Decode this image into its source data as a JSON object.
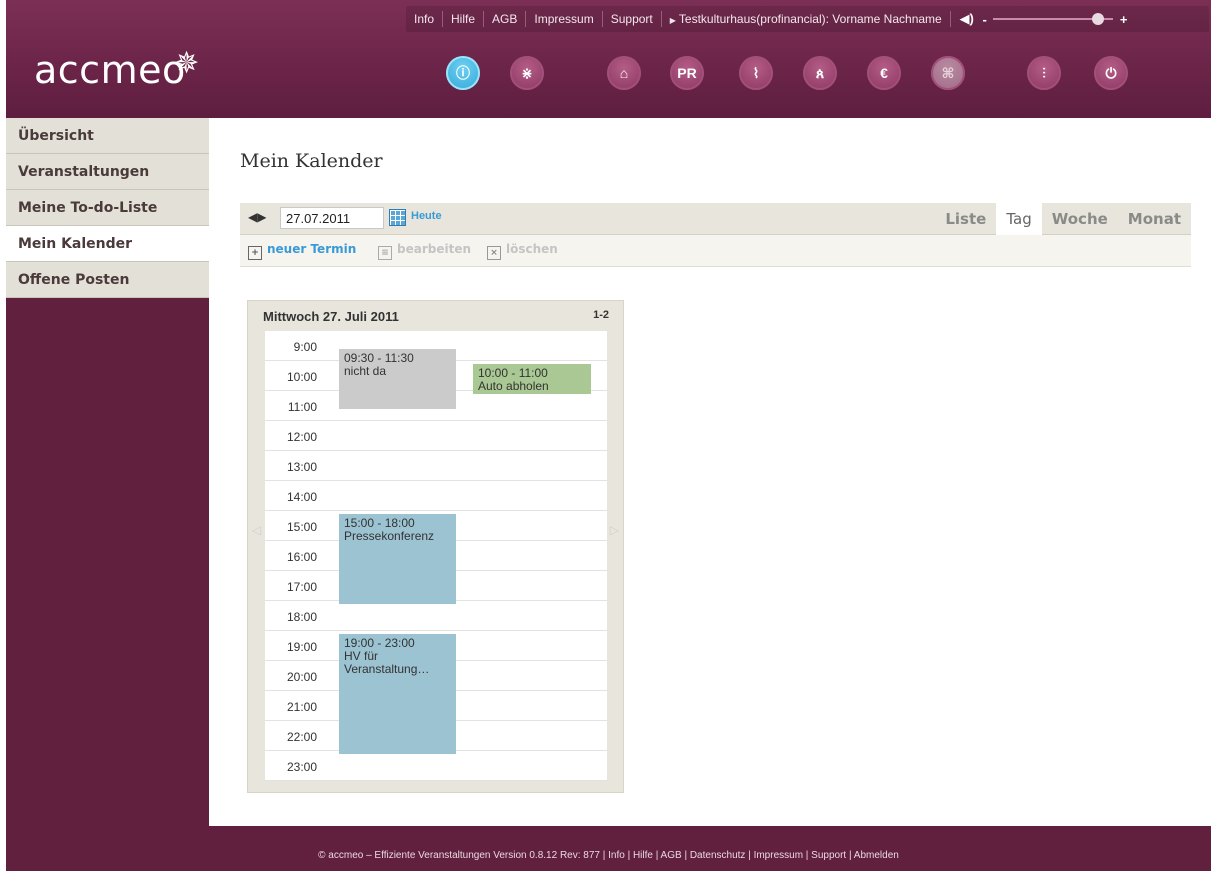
{
  "topnav": {
    "links": [
      "Info",
      "Hilfe",
      "AGB",
      "Impressum",
      "Support"
    ],
    "user": "Testkulturhaus(profinancial): Vorname Nachname",
    "volume_minus": "-",
    "volume_plus": "+",
    "volume_level": 0.92
  },
  "logo": {
    "text": "accmeo"
  },
  "iconbar": [
    {
      "icon": "info-icon",
      "glyph": "ⓘ",
      "active": true
    },
    {
      "icon": "network-icon",
      "glyph": "⋇"
    },
    {
      "icon": "home-icon",
      "glyph": "⌂"
    },
    {
      "icon": "pr-icon",
      "glyph": "PR"
    },
    {
      "icon": "paperclip-icon",
      "glyph": "⌇"
    },
    {
      "icon": "people-icon",
      "glyph": "ጰ"
    },
    {
      "icon": "euro-icon",
      "glyph": "€"
    },
    {
      "icon": "ticket-icon",
      "glyph": "⌘",
      "dim": true
    },
    {
      "icon": "sliders-icon",
      "glyph": "⫶"
    },
    {
      "icon": "power-icon",
      "glyph": "⏻"
    }
  ],
  "sidebar": {
    "items": [
      {
        "label": "Übersicht"
      },
      {
        "label": "Veranstaltungen"
      },
      {
        "label": "Meine To-do-Liste"
      },
      {
        "label": "Mein Kalender",
        "active": true
      },
      {
        "label": "Offene Posten"
      }
    ]
  },
  "main": {
    "title": "Mein Kalender",
    "date_value": "27.07.2011",
    "today_label": "Heute",
    "view_tabs": [
      "Liste",
      "Tag",
      "Woche",
      "Monat"
    ],
    "active_view": "Tag",
    "actions": {
      "new": "neuer Termin",
      "edit": "bearbeiten",
      "delete": "löschen"
    }
  },
  "day": {
    "title": "Mittwoch 27. Juli 2011",
    "range": "1-2",
    "hours": [
      "9:00",
      "10:00",
      "11:00",
      "12:00",
      "13:00",
      "14:00",
      "15:00",
      "16:00",
      "17:00",
      "18:00",
      "19:00",
      "20:00",
      "21:00",
      "22:00",
      "23:00"
    ],
    "events": [
      {
        "time": "09:30 - 11:30",
        "title": "nicht da",
        "color": "gray",
        "start": 9.5,
        "end": 11.5,
        "col": 0
      },
      {
        "time": "10:00 - 11:00",
        "title": "Auto abholen",
        "color": "green",
        "start": 10.0,
        "end": 11.0,
        "col": 1
      },
      {
        "time": "15:00 - 18:00",
        "title": "Pressekonferenz",
        "color": "blue",
        "start": 15.0,
        "end": 18.0,
        "col": 0
      },
      {
        "time": "19:00 - 23:00",
        "title": "HV für Veranstaltung…",
        "color": "blue",
        "start": 19.0,
        "end": 23.0,
        "col": 0
      }
    ]
  },
  "footer": {
    "text": "© accmeo – Effiziente Veranstaltungen Version 0.8.12 Rev: 877 | Info | Hilfe | AGB | Datenschutz | Impressum | Support | Abmelden"
  }
}
